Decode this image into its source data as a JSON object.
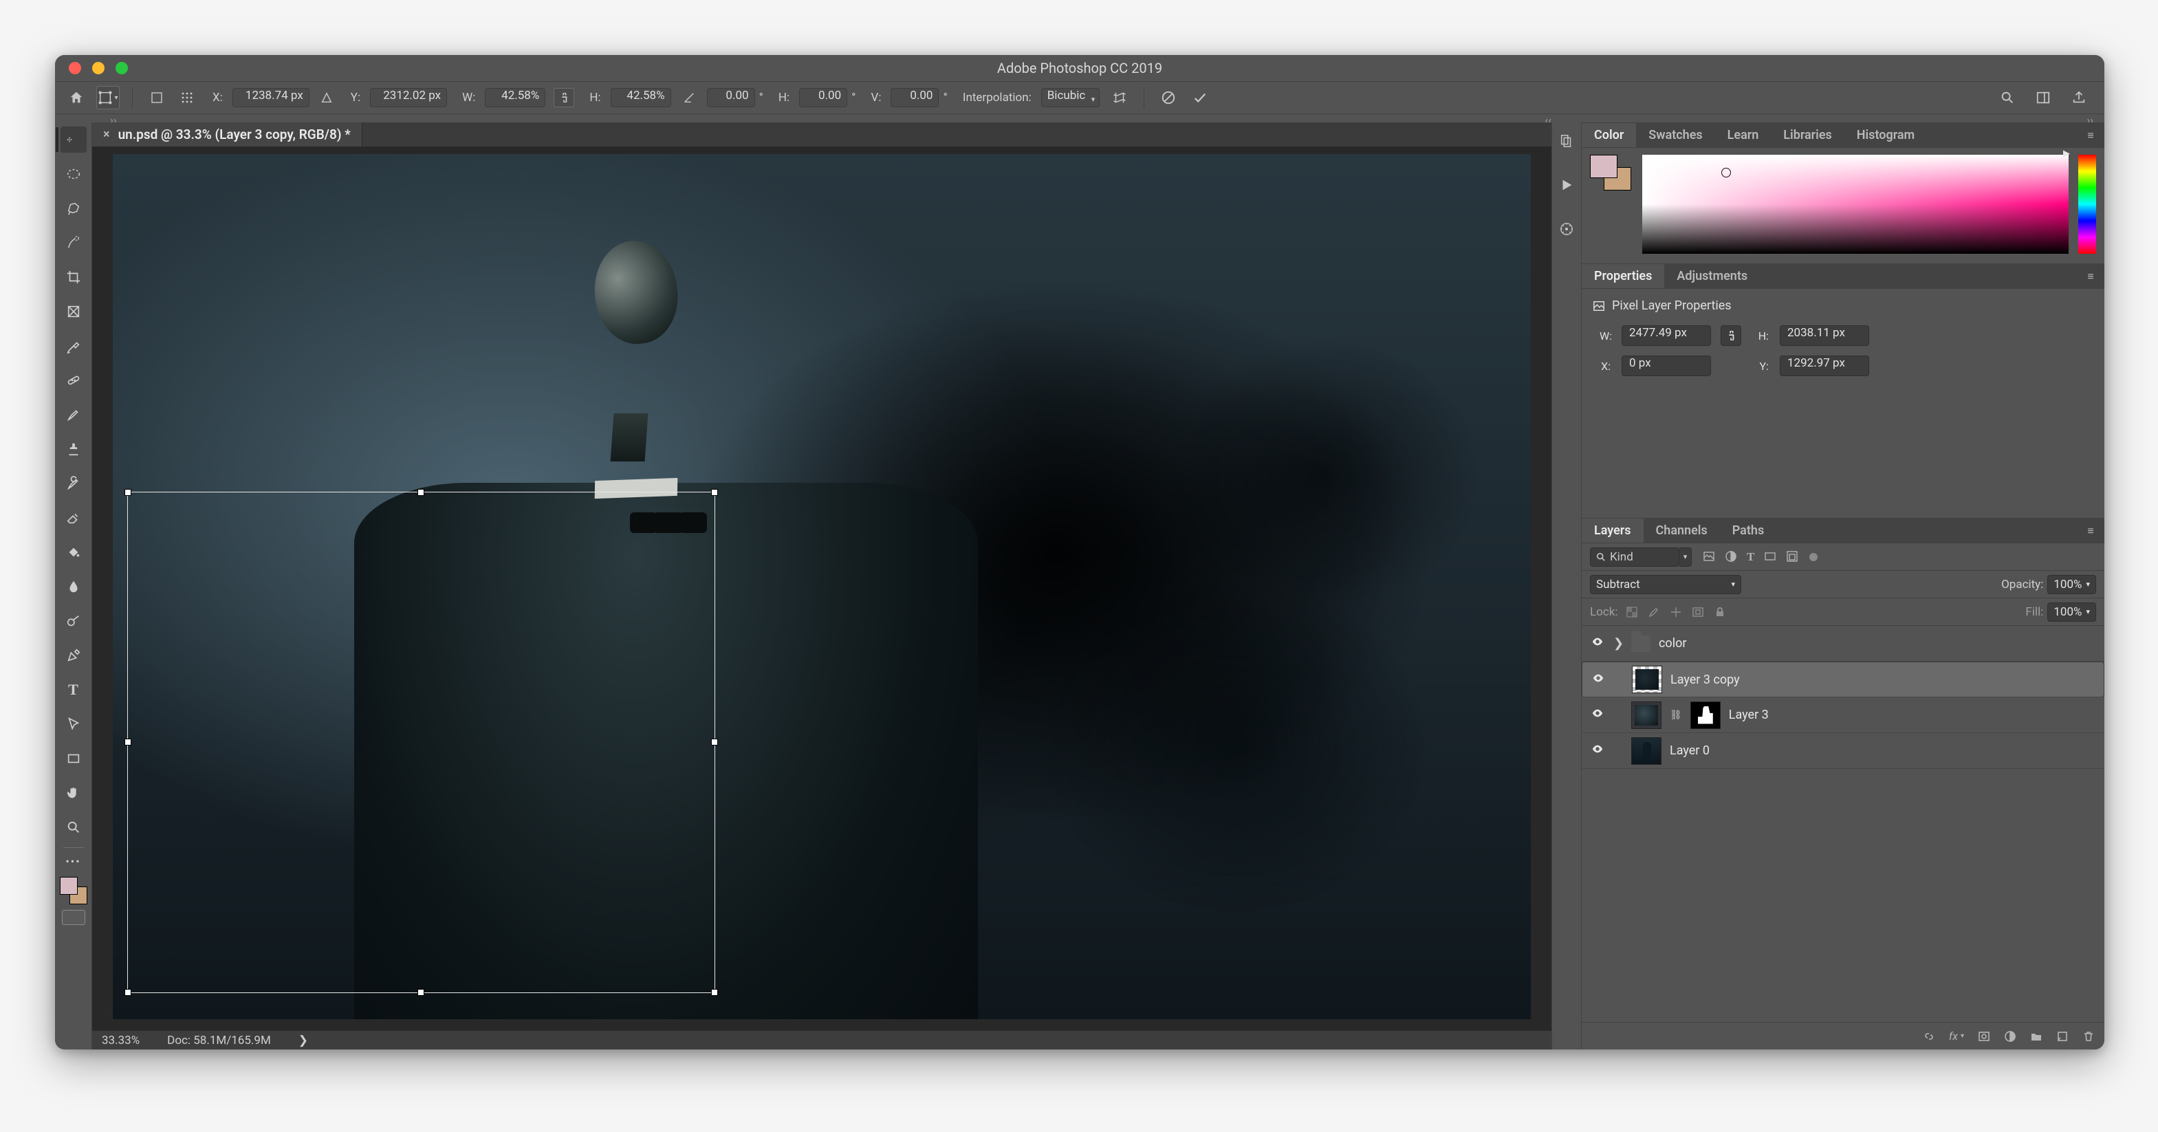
{
  "title": "Adobe Photoshop CC 2019",
  "options": {
    "x_label": "X:",
    "x": "1238.74 px",
    "y_label": "Y:",
    "y": "2312.02 px",
    "w_label": "W:",
    "w": "42.58%",
    "h_label": "H:",
    "h": "42.58%",
    "rot": "0.00",
    "sh_h_label": "H:",
    "sh_h": "0.00",
    "sh_v_label": "V:",
    "sh_v": "0.00",
    "interp_label": "Interpolation:",
    "interp": "Bicubic"
  },
  "tab": {
    "title": "un.psd @ 33.3% (Layer 3 copy, RGB/8) *"
  },
  "status": {
    "zoom": "33.33%",
    "doc_label": "Doc:",
    "doc": "58.1M/165.9M"
  },
  "color_panel": {
    "tabs": [
      "Color",
      "Swatches",
      "Learn",
      "Libraries",
      "Histogram"
    ]
  },
  "properties_panel": {
    "tabs": [
      "Properties",
      "Adjustments"
    ],
    "subtitle": "Pixel Layer Properties",
    "w_label": "W:",
    "w": "2477.49 px",
    "h_label": "H:",
    "h": "2038.11 px",
    "x_label": "X:",
    "x": "0 px",
    "y_label": "Y:",
    "y": "1292.97 px"
  },
  "layers_panel": {
    "tabs": [
      "Layers",
      "Channels",
      "Paths"
    ],
    "filter_placeholder": "Kind",
    "blend_mode": "Subtract",
    "opacity_label": "Opacity:",
    "opacity": "100%",
    "lock_label": "Lock:",
    "fill_label": "Fill:",
    "fill": "100%",
    "items": [
      {
        "name": "color",
        "type": "group"
      },
      {
        "name": "Layer 3 copy",
        "type": "pixel",
        "selected": true
      },
      {
        "name": "Layer 3",
        "type": "pixel_masked"
      },
      {
        "name": "Layer 0",
        "type": "pixel"
      }
    ]
  }
}
